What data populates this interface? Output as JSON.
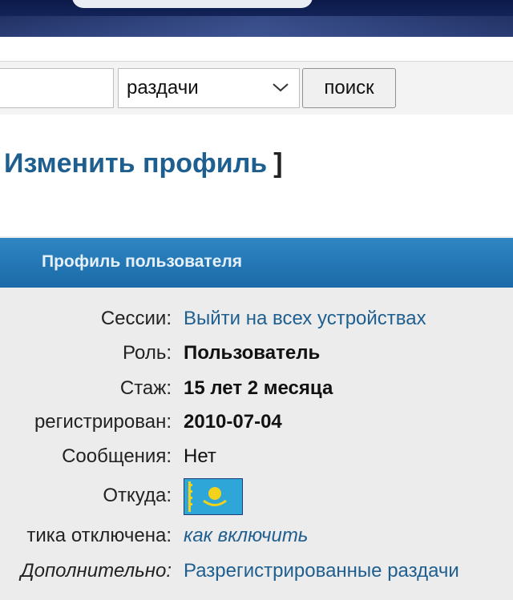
{
  "search": {
    "input_value": "",
    "select_value": "раздачи",
    "button_label": "поиск"
  },
  "page": {
    "title": "Изменить профиль",
    "title_bracket": "]"
  },
  "section": {
    "header": "Профиль пользователя"
  },
  "profile": {
    "rows": [
      {
        "label": "Сессии:",
        "value": "Выйти на всех устройствах"
      },
      {
        "label": "Роль:",
        "value": "Пользователь"
      },
      {
        "label": "Стаж:",
        "value": "15 лет 2 месяца"
      },
      {
        "label": "регистрирован:",
        "value": "2010-07-04"
      },
      {
        "label": "Сообщения:",
        "value": "Нет"
      },
      {
        "label": "Откуда:",
        "value_icon": "kazakhstan-flag-icon"
      },
      {
        "label": "тика отключена:",
        "value": "как включить"
      },
      {
        "label": "Дополнительно:",
        "value": "Разрегистрированные раздачи"
      }
    ]
  },
  "colors": {
    "link": "#1f5f8f",
    "header_bg": "#1a6aa7",
    "flag_bg": "#2ea7d8",
    "flag_gold": "#f2d21b"
  }
}
